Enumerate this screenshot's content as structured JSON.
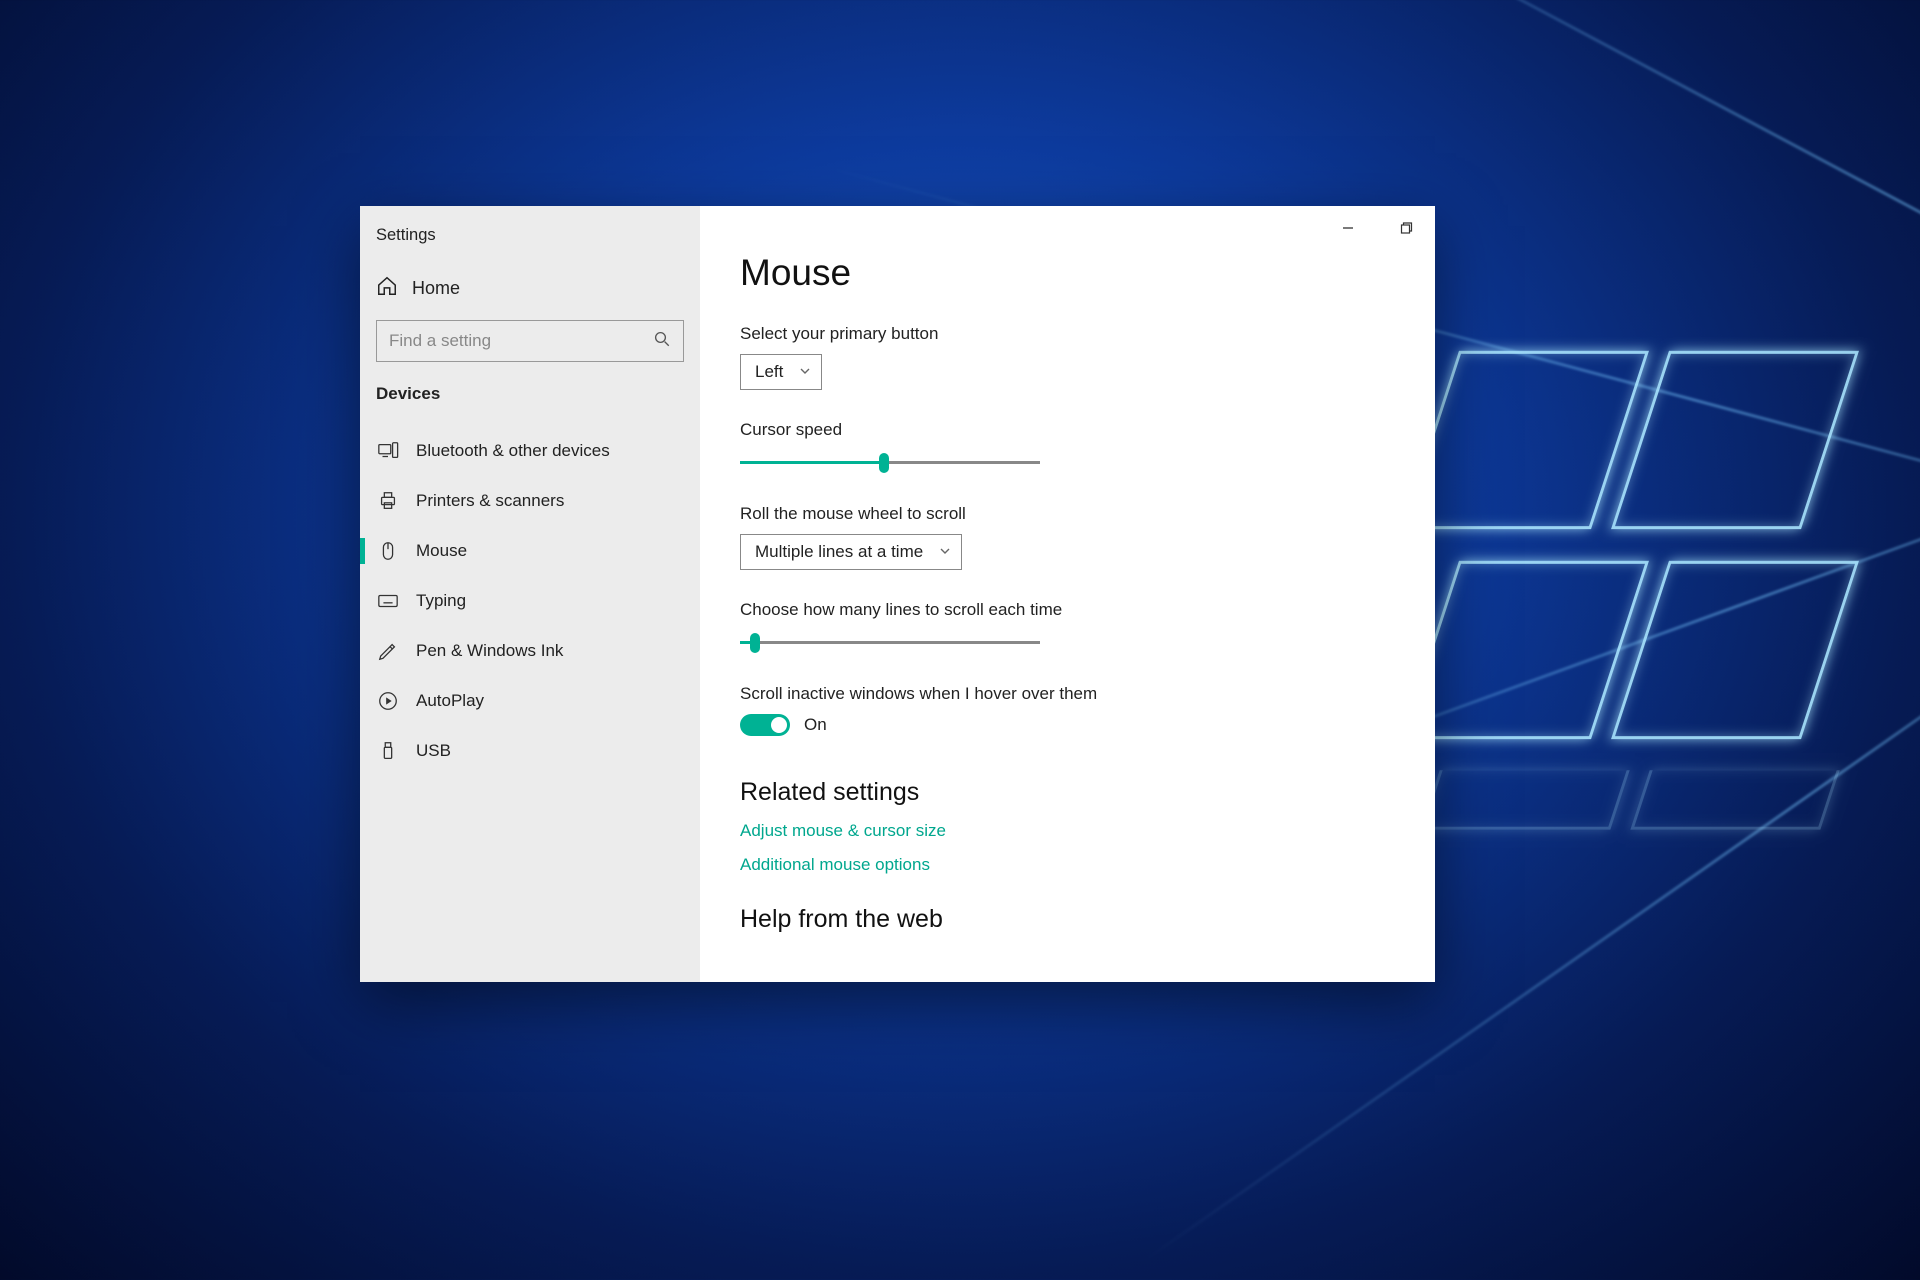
{
  "app": {
    "title": "Settings"
  },
  "window_controls": {
    "minimize": "minimize",
    "maximize": "maximize"
  },
  "sidebar": {
    "home": "Home",
    "search_placeholder": "Find a setting",
    "category": "Devices",
    "items": [
      {
        "label": "Bluetooth & other devices"
      },
      {
        "label": "Printers & scanners"
      },
      {
        "label": "Mouse"
      },
      {
        "label": "Typing"
      },
      {
        "label": "Pen & Windows Ink"
      },
      {
        "label": "AutoPlay"
      },
      {
        "label": "USB"
      }
    ]
  },
  "main": {
    "title": "Mouse",
    "primary_button": {
      "label": "Select your primary button",
      "value": "Left"
    },
    "cursor_speed": {
      "label": "Cursor speed",
      "percent": 48
    },
    "scroll_mode": {
      "label": "Roll the mouse wheel to scroll",
      "value": "Multiple lines at a time"
    },
    "scroll_lines": {
      "label": "Choose how many lines to scroll each time",
      "percent": 5
    },
    "scroll_inactive": {
      "label": "Scroll inactive windows when I hover over them",
      "state": "On"
    },
    "related": {
      "heading": "Related settings",
      "links": [
        "Adjust mouse & cursor size",
        "Additional mouse options"
      ]
    },
    "help": {
      "heading": "Help from the web"
    }
  },
  "colors": {
    "accent": "#00b294"
  }
}
